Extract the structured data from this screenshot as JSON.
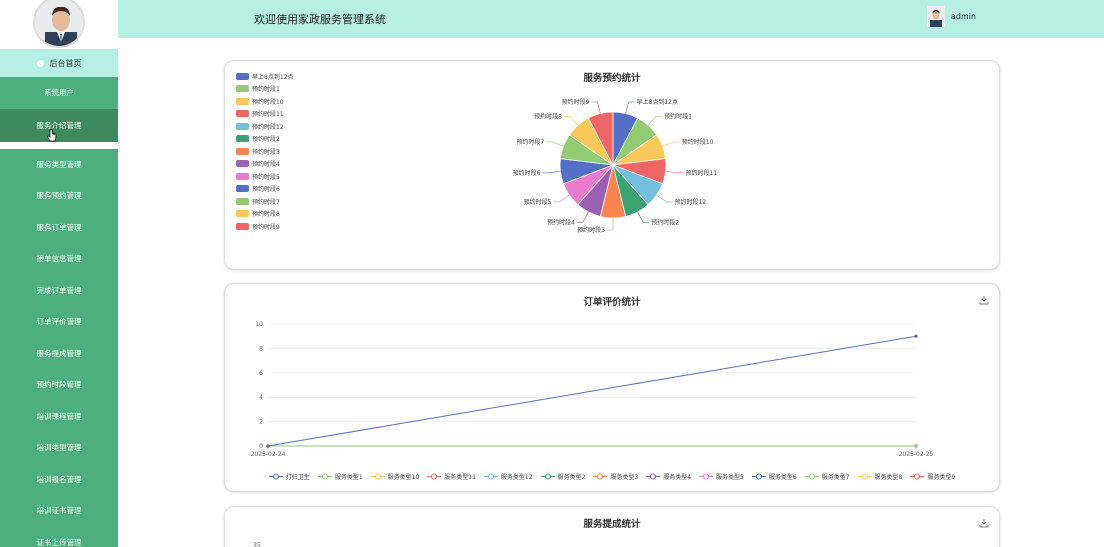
{
  "header": {
    "title": "欢迎使用家政服务管理系统",
    "username": "admin"
  },
  "sidebar": {
    "home": "后台首页",
    "items": [
      "系统用户",
      "服务介绍管理",
      "服务类型管理",
      "服务预约管理",
      "服务订单管理",
      "接单信息管理",
      "完成订单管理",
      "订单评价管理",
      "服务提成管理",
      "预约时段管理",
      "培训课程管理",
      "培训类型管理",
      "培训报名管理",
      "培训证书管理",
      "证书上传管理"
    ],
    "active_index": 1
  },
  "colors": {
    "sidebar": "#4caf7d",
    "sidebar_active": "#3d8a5f",
    "header": "#b6efe3"
  },
  "chart_data": [
    {
      "type": "pie",
      "title": "服务预约统计",
      "categories": [
        "早上8点到12点",
        "预约时段1",
        "预约时段10",
        "预约时段11",
        "预约时段12",
        "预约时段2",
        "预约时段3",
        "预约时段4",
        "预约时段5",
        "预约时段6",
        "预约时段7",
        "预约时段8",
        "预约时段9"
      ],
      "values": [
        1,
        1,
        1,
        1,
        1,
        1,
        1,
        1,
        1,
        1,
        1,
        1,
        1
      ],
      "colors": [
        "#5470c6",
        "#91cc75",
        "#fac858",
        "#ee6666",
        "#73c0de",
        "#3ba272",
        "#fc8452",
        "#9a60b4",
        "#ea7ccc",
        "#5470c6",
        "#91cc75",
        "#fac858",
        "#ee6666"
      ],
      "legend": "top-left"
    },
    {
      "type": "line",
      "title": "订单评价统计",
      "x": [
        "2025-02-24",
        "2025-02-25"
      ],
      "ylim": [
        0,
        10
      ],
      "yticks": [
        "0",
        "2",
        "4",
        "6",
        "8",
        "10"
      ],
      "series": [
        {
          "name": "打扫卫生",
          "values": [
            0,
            9
          ],
          "color": "#5470c6"
        },
        {
          "name": "服务类型1",
          "values": [
            0,
            0
          ],
          "color": "#91cc75"
        },
        {
          "name": "服务类型10",
          "values": [
            0,
            0
          ],
          "color": "#fac858"
        },
        {
          "name": "服务类型11",
          "values": [
            0,
            0
          ],
          "color": "#ee6666"
        },
        {
          "name": "服务类型12",
          "values": [
            0,
            0
          ],
          "color": "#73c0de"
        },
        {
          "name": "服务类型2",
          "values": [
            0,
            0
          ],
          "color": "#3ba272"
        },
        {
          "name": "服务类型3",
          "values": [
            0,
            0
          ],
          "color": "#fc8452"
        },
        {
          "name": "服务类型4",
          "values": [
            0,
            0
          ],
          "color": "#9a60b4"
        },
        {
          "name": "服务类型5",
          "values": [
            0,
            0
          ],
          "color": "#ea7ccc"
        },
        {
          "name": "服务类型6",
          "values": [
            0,
            0
          ],
          "color": "#5470c6"
        },
        {
          "name": "服务类型7",
          "values": [
            0,
            0
          ],
          "color": "#91cc75"
        },
        {
          "name": "服务类型8",
          "values": [
            0,
            0
          ],
          "color": "#fac858"
        },
        {
          "name": "服务类型9",
          "values": [
            0,
            0
          ],
          "color": "#ee6666"
        }
      ],
      "legend": "bottom",
      "grid": true
    },
    {
      "type": "line",
      "title": "服务提成统计",
      "yticks": [
        "35"
      ]
    }
  ]
}
